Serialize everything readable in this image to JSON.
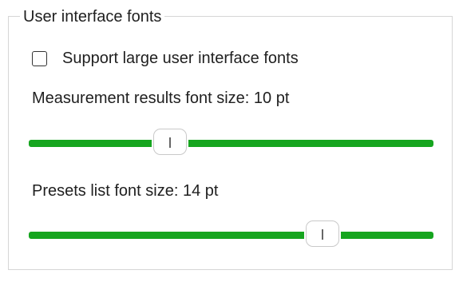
{
  "group": {
    "title": "User interface fonts"
  },
  "large_fonts": {
    "label": "Support large user interface fonts",
    "checked": false
  },
  "measurement_font": {
    "label": "Measurement results font size: 10 pt",
    "value_pt": 10,
    "position_fraction": 0.35
  },
  "presets_font": {
    "label": "Presets list font size: 14 pt",
    "value_pt": 14,
    "position_fraction": 0.725
  },
  "colors": {
    "slider_track": "#16a51f",
    "group_border": "#d6d6d6"
  }
}
